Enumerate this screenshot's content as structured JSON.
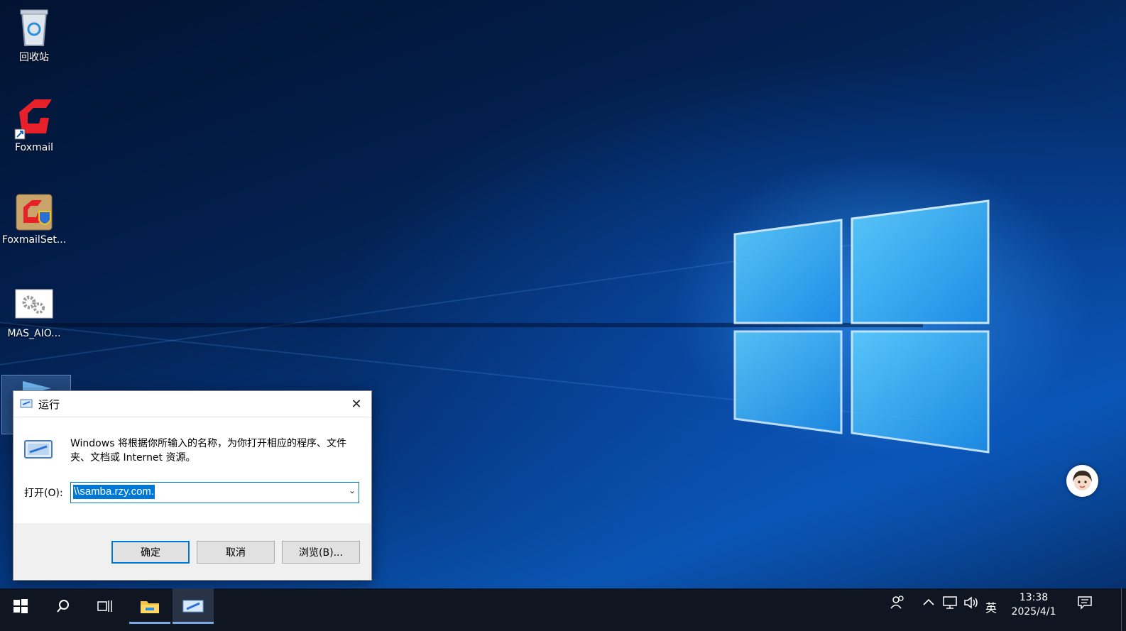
{
  "desktop": {
    "icons": [
      {
        "label": "回收站",
        "icon": "recycle-bin-icon"
      },
      {
        "label": "Foxmail",
        "icon": "foxmail-icon"
      },
      {
        "label": "FoxmailSet...",
        "icon": "foxmail-setup-icon"
      },
      {
        "label": "MAS_AIO...",
        "icon": "settings-gear-icon"
      },
      {
        "label": "",
        "icon": "run-shortcut-icon"
      }
    ]
  },
  "run_dialog": {
    "title": "运行",
    "description": "Windows 将根据你所输入的名称，为你打开相应的程序、文件夹、文档或 Internet 资源。",
    "open_label": "打开(O):",
    "input_value": "\\\\samba.rzy.com.",
    "buttons": {
      "ok": "确定",
      "cancel": "取消",
      "browse": "浏览(B)..."
    }
  },
  "taskbar": {
    "items": [
      "start-icon",
      "search-icon",
      "task-view-icon",
      "file-explorer-icon",
      "run-app-icon"
    ],
    "tray": {
      "ime": "英",
      "time": "13:38",
      "date": "2025/4/1"
    }
  },
  "colors": {
    "accent": "#0078d7",
    "taskbar": "#101522"
  }
}
